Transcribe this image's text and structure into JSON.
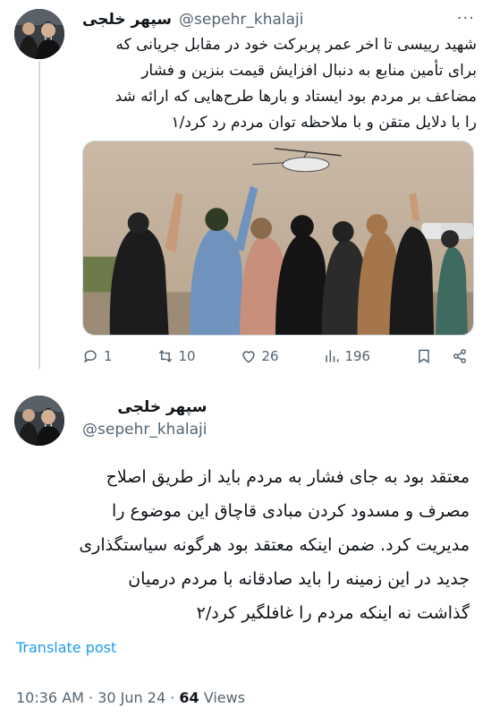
{
  "author": {
    "name": "سپهر خلجی",
    "handle": "@sepehr_khalaji"
  },
  "tweet1": {
    "more_label": "···",
    "text": "شهید رییسی تا اخر عمر پربرکت خود در مقابل جریانی که\nبرای تأمین منابع به دنبال افزایش قیمت بنزین و فشار\nمضاعف بر مردم بود ایستاد و بارها طرح‌هایی که ارائه شد\nرا با دلایل متقن و با ملاحظه توان مردم رد کرد/۱",
    "actions": {
      "replies": "1",
      "reposts": "10",
      "likes": "26",
      "views": "196"
    },
    "icons": [
      "reply-icon",
      "repost-icon",
      "like-icon",
      "views-icon",
      "bookmark-icon",
      "share-icon"
    ]
  },
  "tweet2": {
    "text": "معتقد بود به جای فشار به مردم باید از طریق اصلاح\nمصرف و مسدود کردن مبادی قاچاق این موضوع را\nمدیریت کرد. ضمن اینکه معتقد بود هرگونه سیاستگذاری\nجدید در این زمینه را باید صادقانه با مردم درمیان\nگذاشت نه اینکه مردم را غافلگیر کرد/۲",
    "translate_label": "Translate post",
    "time": "10:36 AM",
    "separator": "·",
    "date": "30 Jun 24",
    "views_count": "64",
    "views_label": "Views"
  },
  "colors": {
    "accent": "#1d9bf0",
    "secondary_text": "#536471",
    "border": "#cfd9de"
  }
}
